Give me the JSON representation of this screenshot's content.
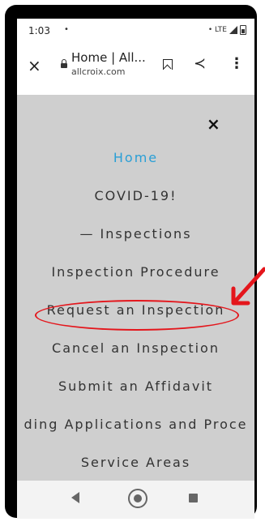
{
  "status_bar": {
    "time": "1:03",
    "dot": "•",
    "network": "• LTE"
  },
  "browser": {
    "close_glyph": "×",
    "page_title": "Home | All...",
    "domain": "allcroix.com",
    "share_glyph": "≺",
    "menu_glyph": "⋮"
  },
  "menu": {
    "close_glyph": "×",
    "items": [
      {
        "label": "Home",
        "active": true
      },
      {
        "label": "COVID-19!"
      },
      {
        "label": "— Inspections"
      },
      {
        "label": "Inspection Procedure"
      },
      {
        "label": "Request an Inspection",
        "highlighted": true
      },
      {
        "label": "Cancel an Inspection"
      },
      {
        "label": "Submit an Affidavit"
      },
      {
        "label": "ding Applications and Proce"
      },
      {
        "label": "Service Areas"
      }
    ]
  },
  "colors": {
    "active_link": "#2a9fd6",
    "annotation": "#e4161c",
    "menu_background": "#cfcfcf"
  }
}
